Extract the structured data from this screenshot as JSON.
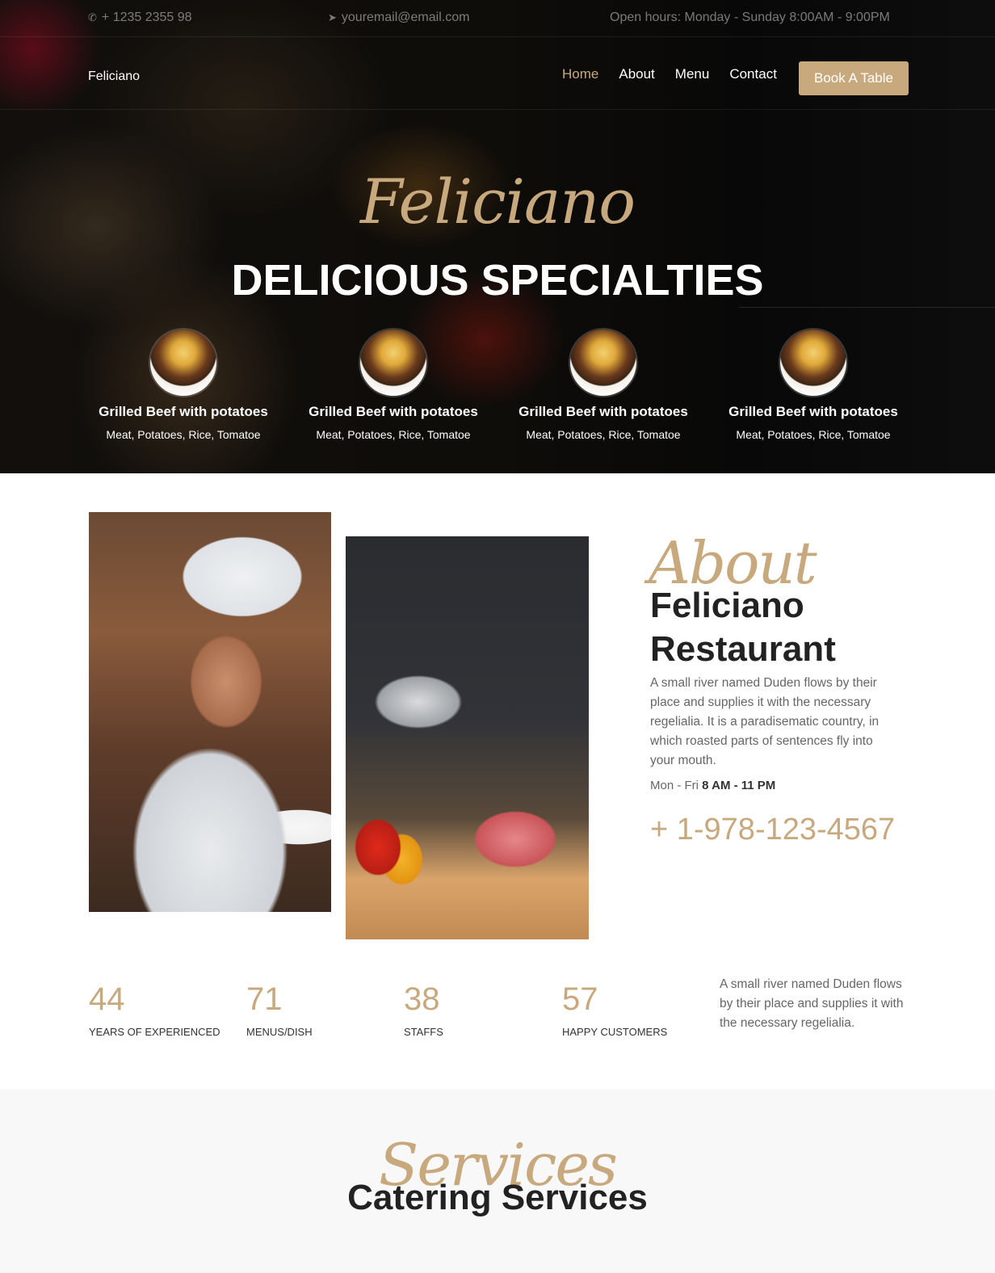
{
  "topbar": {
    "phone": "+ 1235 2355 98",
    "email": "youremail@email.com",
    "hours": "Open hours: Monday - Sunday 8:00AM - 9:00PM"
  },
  "navbar": {
    "brand": "Feliciano",
    "links": [
      "Home",
      "About",
      "Menu",
      "Contact"
    ],
    "active": "Home",
    "book_button": "Book A Table"
  },
  "hero": {
    "script_title": "Feliciano",
    "title": "DELICIOUS SPECIALTIES",
    "dishes": [
      {
        "name": "Grilled Beef with potatoes",
        "ingredients": "Meat, Potatoes, Rice, Tomatoe"
      },
      {
        "name": "Grilled Beef with potatoes",
        "ingredients": "Meat, Potatoes, Rice, Tomatoe"
      },
      {
        "name": "Grilled Beef with potatoes",
        "ingredients": "Meat, Potatoes, Rice, Tomatoe"
      },
      {
        "name": "Grilled Beef with potatoes",
        "ingredients": "Meat, Potatoes, Rice, Tomatoe"
      }
    ]
  },
  "about": {
    "script_title": "About",
    "title_line1": "Feliciano",
    "title_line2": "Restaurant",
    "text": "A small river named Duden flows by their place and supplies it with the necessary regelialia. It is a paradisematic country, in which roasted parts of sentences fly into your mouth.",
    "hours_prefix": "Mon - Fri",
    "hours_value": "8 AM - 11 PM",
    "phone": "+ 1-978-123-4567"
  },
  "stats": {
    "items": [
      {
        "number": "44",
        "label": "YEARS OF EXPERIENCED"
      },
      {
        "number": "71",
        "label": "MENUS/DISH"
      },
      {
        "number": "38",
        "label": "STAFFS"
      },
      {
        "number": "57",
        "label": "HAPPY CUSTOMERS"
      }
    ],
    "text": "A small river named Duden flows by their place and supplies it with the necessary regelialia."
  },
  "services": {
    "script_title": "Services",
    "title": "Catering Services"
  },
  "colors": {
    "accent": "#c8a97e",
    "dark_text": "#222222",
    "body_text": "#666666",
    "section_bg": "#f8f8f8"
  },
  "icons": {
    "phone": "phone-icon",
    "email": "paper-plane-icon"
  }
}
